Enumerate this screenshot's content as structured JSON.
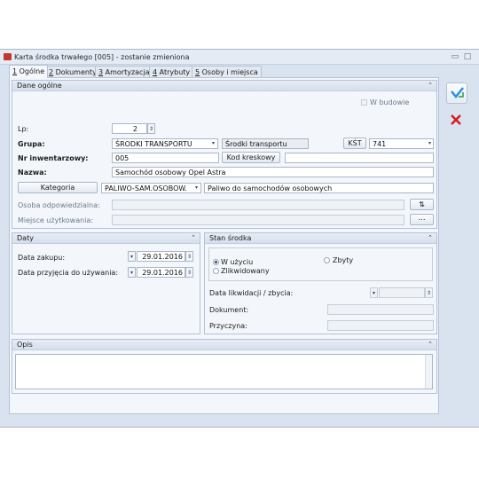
{
  "window": {
    "title": "Karta środka trwałego [005] - zostanie zmieniona",
    "minimize": "▭",
    "maximize": "□"
  },
  "tabs": [
    {
      "key": "1",
      "label": " Ogólne"
    },
    {
      "key": "2",
      "label": " Dokumenty"
    },
    {
      "key": "3",
      "label": " Amortyzacja"
    },
    {
      "key": "4",
      "label": " Atrybuty"
    },
    {
      "key": "5",
      "label": " Osoby i miejsca"
    }
  ],
  "dane_ogolne": {
    "header": "Dane ogólne",
    "w_budowie": "W budowie",
    "lp_label": "Lp:",
    "lp_value": "2",
    "grupa_label": "Grupa:",
    "grupa_value": "ŚRODKI TRANSPORTU",
    "grupa_desc": "Środki transportu",
    "kst_button": "KŚT",
    "kst_value": "741",
    "nr_label": "Nr inwentarzowy:",
    "nr_value": "005",
    "kod_button": "Kod kreskowy",
    "kod_value": "",
    "nazwa_label": "Nazwa:",
    "nazwa_value": "Samochód osobowy Opel Astra",
    "kategoria_button": "Kategoria",
    "kategoria_value": "PALIWO-SAM.OSOBOW.",
    "kategoria_desc": "Paliwo do samochodów osobowych",
    "osoba_label": "Osoba odpowiedzialna:",
    "osoba_value": "",
    "miejsce_label": "Miejsce użytkowania:",
    "miejsce_value": ""
  },
  "daty": {
    "header": "Daty",
    "zakup_label": "Data zakupu:",
    "zakup_value": "29.01.2016",
    "przyjecie_label": "Data przyjęcia do używania:",
    "przyjecie_value": "29.01.2016"
  },
  "stan": {
    "header": "Stan środka",
    "w_uzyciu": "W użyciu",
    "zlikwidowany": "Zlikwidowany",
    "zbyty": "Zbyty",
    "selected": "w_uzyciu",
    "data_likw_label": "Data likwidacji / zbycia:",
    "dokument_label": "Dokument:",
    "przyczyna_label": "Przyczyna:"
  },
  "opis": {
    "header": "Opis",
    "value": ""
  },
  "collapse_glyph": "⌃",
  "colors": {
    "accent_red": "#d11f1f",
    "save_green": "#2f8fd8"
  }
}
